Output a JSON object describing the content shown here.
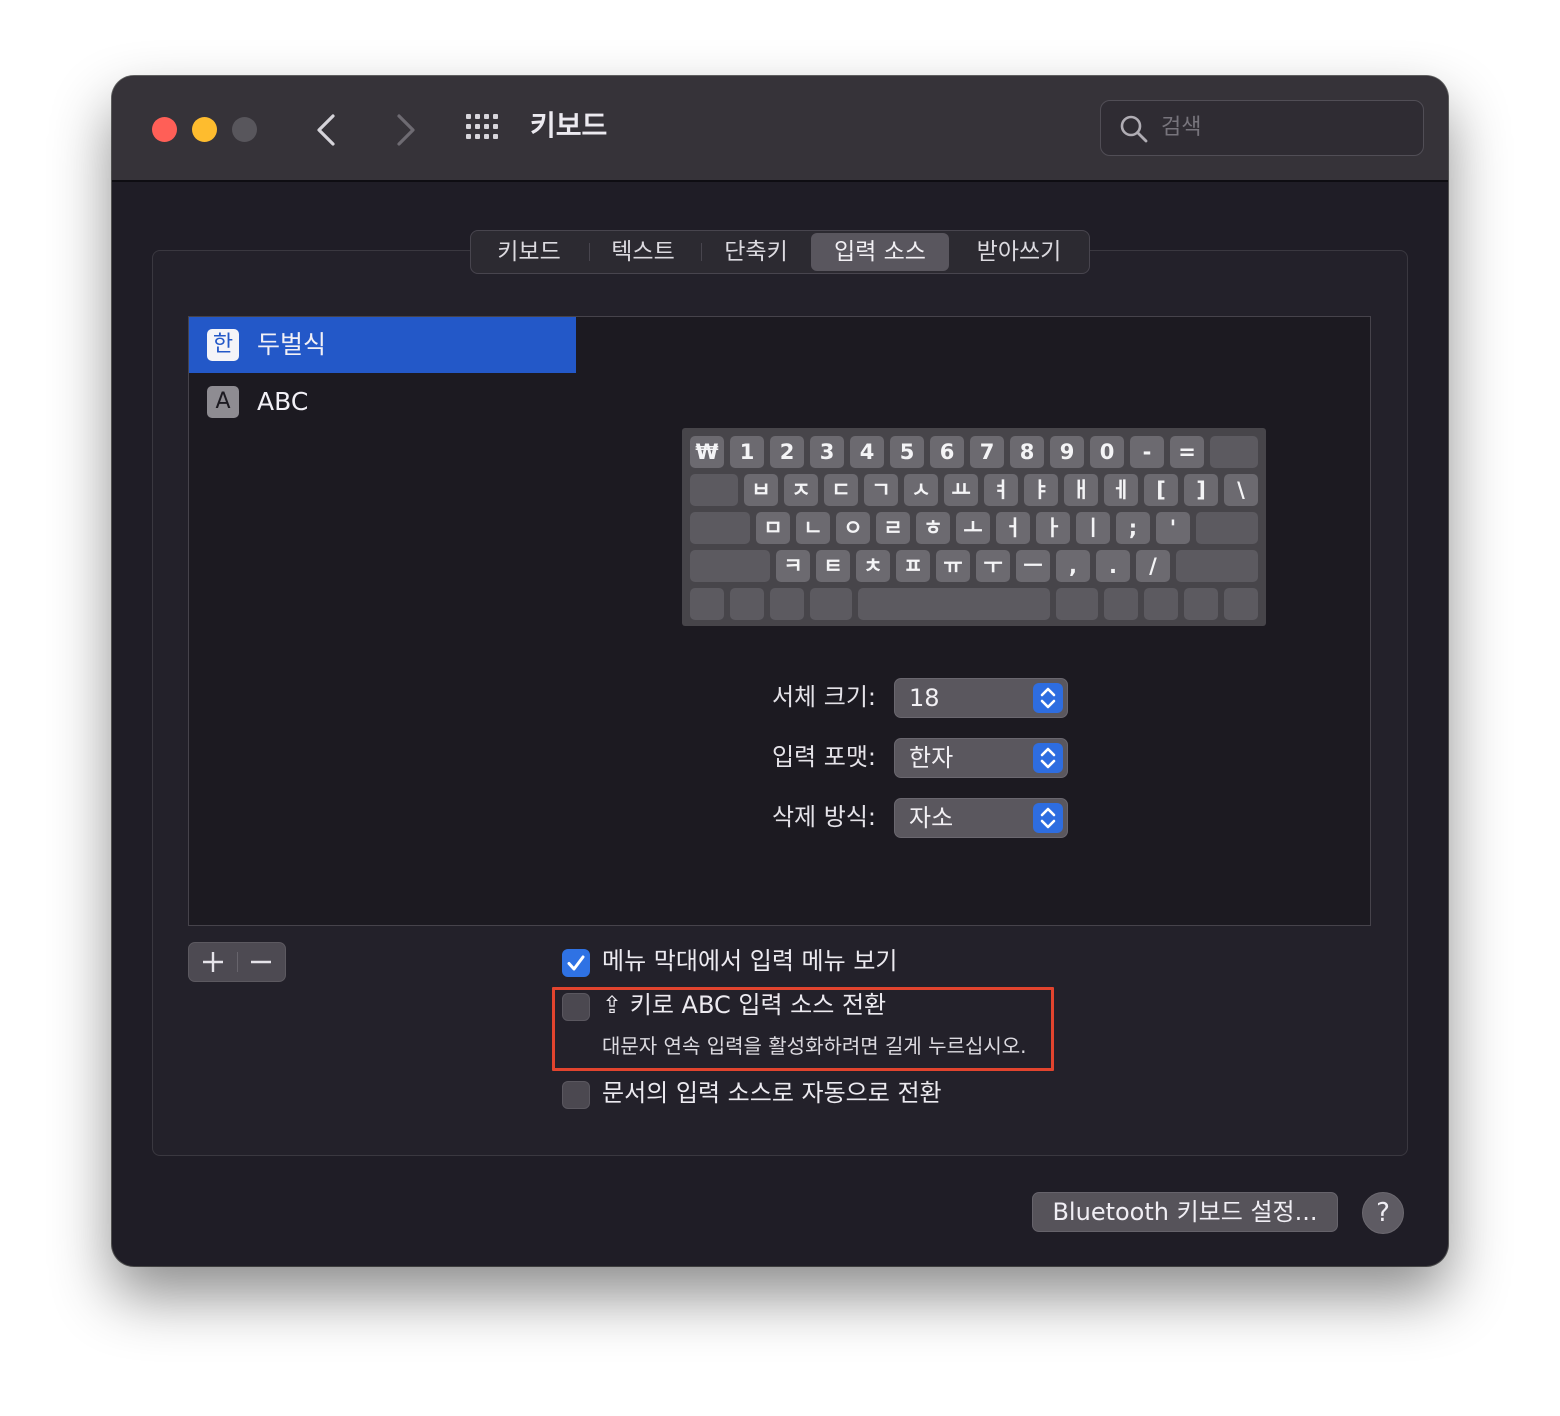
{
  "window": {
    "title": "키보드"
  },
  "search": {
    "placeholder": "검색"
  },
  "tabs": [
    {
      "label": "키보드"
    },
    {
      "label": "텍스트"
    },
    {
      "label": "단축키"
    },
    {
      "label": "입력 소스",
      "active": true
    },
    {
      "label": "받아쓰기"
    }
  ],
  "sources": [
    {
      "icon_text": "한",
      "label": "두벌식",
      "selected": true
    },
    {
      "icon_text": "A",
      "label": "ABC",
      "selected": false
    }
  ],
  "keyboard": {
    "row1": [
      "₩",
      "1",
      "2",
      "3",
      "4",
      "5",
      "6",
      "7",
      "8",
      "9",
      "0",
      "-",
      "="
    ],
    "row2": [
      "ㅂ",
      "ㅈ",
      "ㄷ",
      "ㄱ",
      "ㅅ",
      "ㅛ",
      "ㅕ",
      "ㅑ",
      "ㅐ",
      "ㅔ",
      "[",
      "]",
      "\\"
    ],
    "row3": [
      "ㅁ",
      "ㄴ",
      "ㅇ",
      "ㄹ",
      "ㅎ",
      "ㅗ",
      "ㅓ",
      "ㅏ",
      "ㅣ",
      ";",
      "'"
    ],
    "row4": [
      "ㅋ",
      "ㅌ",
      "ㅊ",
      "ㅍ",
      "ㅠ",
      "ㅜ",
      "ㅡ",
      ",",
      ".",
      "/"
    ]
  },
  "options": {
    "font_size": {
      "label": "서체 크기:",
      "value": "18"
    },
    "input_format": {
      "label": "입력 포맷:",
      "value": "한자"
    },
    "delete_method": {
      "label": "삭제 방식:",
      "value": "자소"
    }
  },
  "checkboxes": {
    "show_input_menu": {
      "label": "메뉴 막대에서 입력 메뉴 보기",
      "checked": true
    },
    "caps_switch": {
      "glyph": "⇪",
      "label": "키로 ABC 입력 소스 전환",
      "sub": "대문자 연속 입력을 활성화하려면 길게 누르십시오.",
      "checked": false
    },
    "auto_switch": {
      "label": "문서의 입력 소스로 자동으로 전환",
      "checked": false
    }
  },
  "buttons": {
    "add": "+",
    "remove": "−",
    "bluetooth": "Bluetooth 키보드 설정...",
    "help": "?"
  },
  "colors": {
    "accent": "#2f72e4",
    "selection": "#2358c8",
    "highlight": "#e2442e",
    "close": "#ff5f57",
    "minimize": "#febc2e",
    "zoom_disabled": "#58565c"
  }
}
